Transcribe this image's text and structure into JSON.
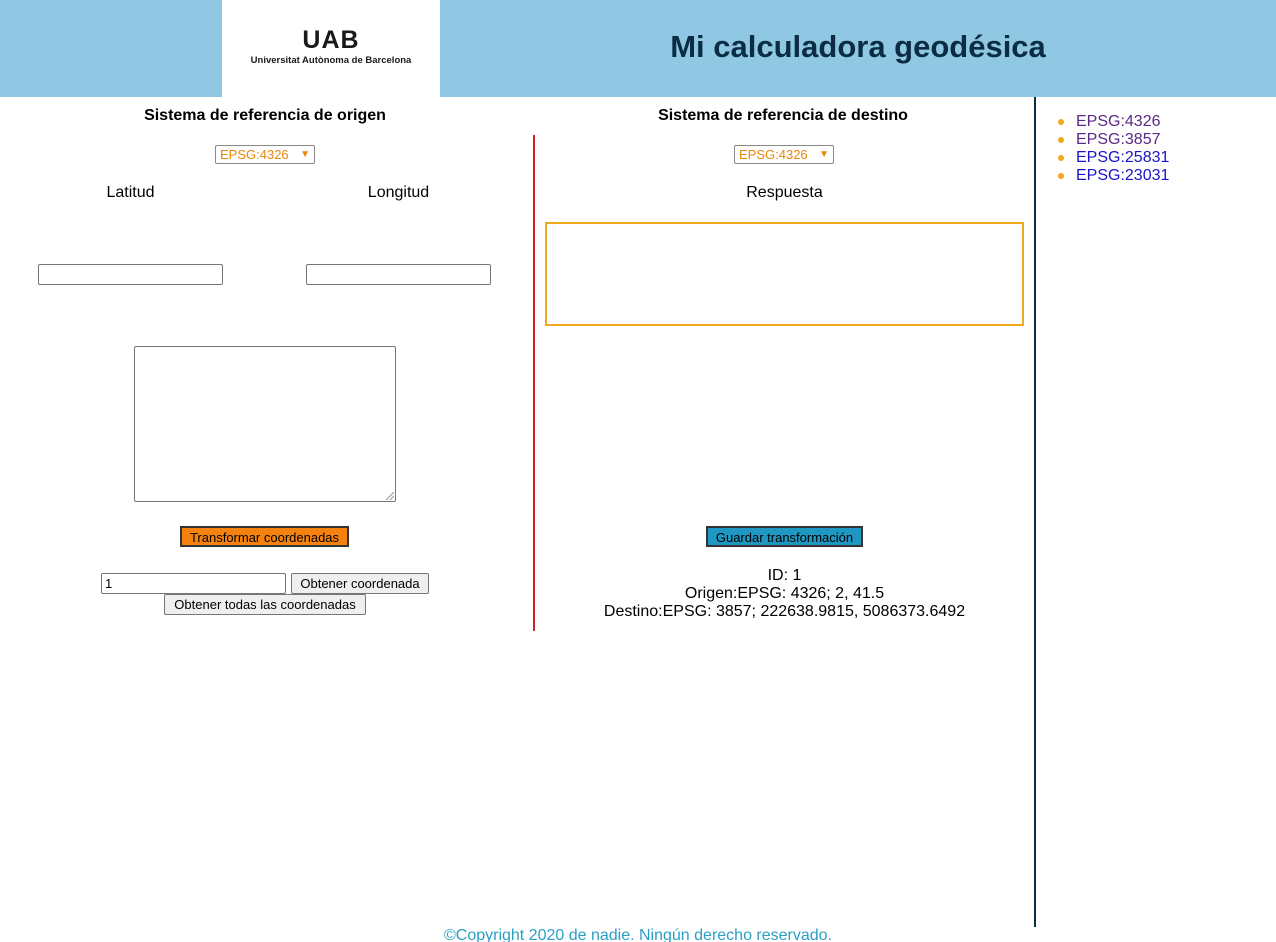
{
  "header": {
    "logo_mark": "UAB",
    "logo_subtitle": "Universitat Autònoma de Barcelona",
    "title": "Mi calculadora geodésica"
  },
  "origin": {
    "heading": "Sistema de referencia de origen",
    "selected_crs": "EPSG:4326",
    "latitude_label": "Latitud",
    "longitude_label": "Longitud",
    "latitude_value": "",
    "longitude_value": "",
    "textarea_value": "",
    "transform_button": "Transformar coordenadas",
    "id_input_value": "1",
    "get_button": "Obtener coordenada",
    "get_all_button": "Obtener todas las coordenadas"
  },
  "destination": {
    "heading": "Sistema de referencia de destino",
    "selected_crs": "EPSG:4326",
    "answer_label": "Respuesta",
    "answer_value": "",
    "save_button": "Guardar transformación",
    "result_id": "ID: 1",
    "result_origin": "Origen:EPSG: 4326; 2, 41.5",
    "result_destination": "Destino:EPSG: 3857; 222638.9815, 5086373.6492"
  },
  "sidebar": {
    "links": [
      {
        "label": "EPSG:4326",
        "visited": true
      },
      {
        "label": "EPSG:3857",
        "visited": true
      },
      {
        "label": "EPSG:25831",
        "visited": false
      },
      {
        "label": "EPSG:23031",
        "visited": false
      }
    ]
  },
  "footer": {
    "text": "©Copyright 2020 de nadie. Ningún derecho reservado."
  },
  "colors": {
    "header_bg": "#90c8e3",
    "title_text": "#0b2d44",
    "transform_button": "#f5820f",
    "save_button": "#1e98c2",
    "answer_border": "#f0a81e",
    "divider_red": "#d42020",
    "footer_text": "#2a9fc6"
  }
}
